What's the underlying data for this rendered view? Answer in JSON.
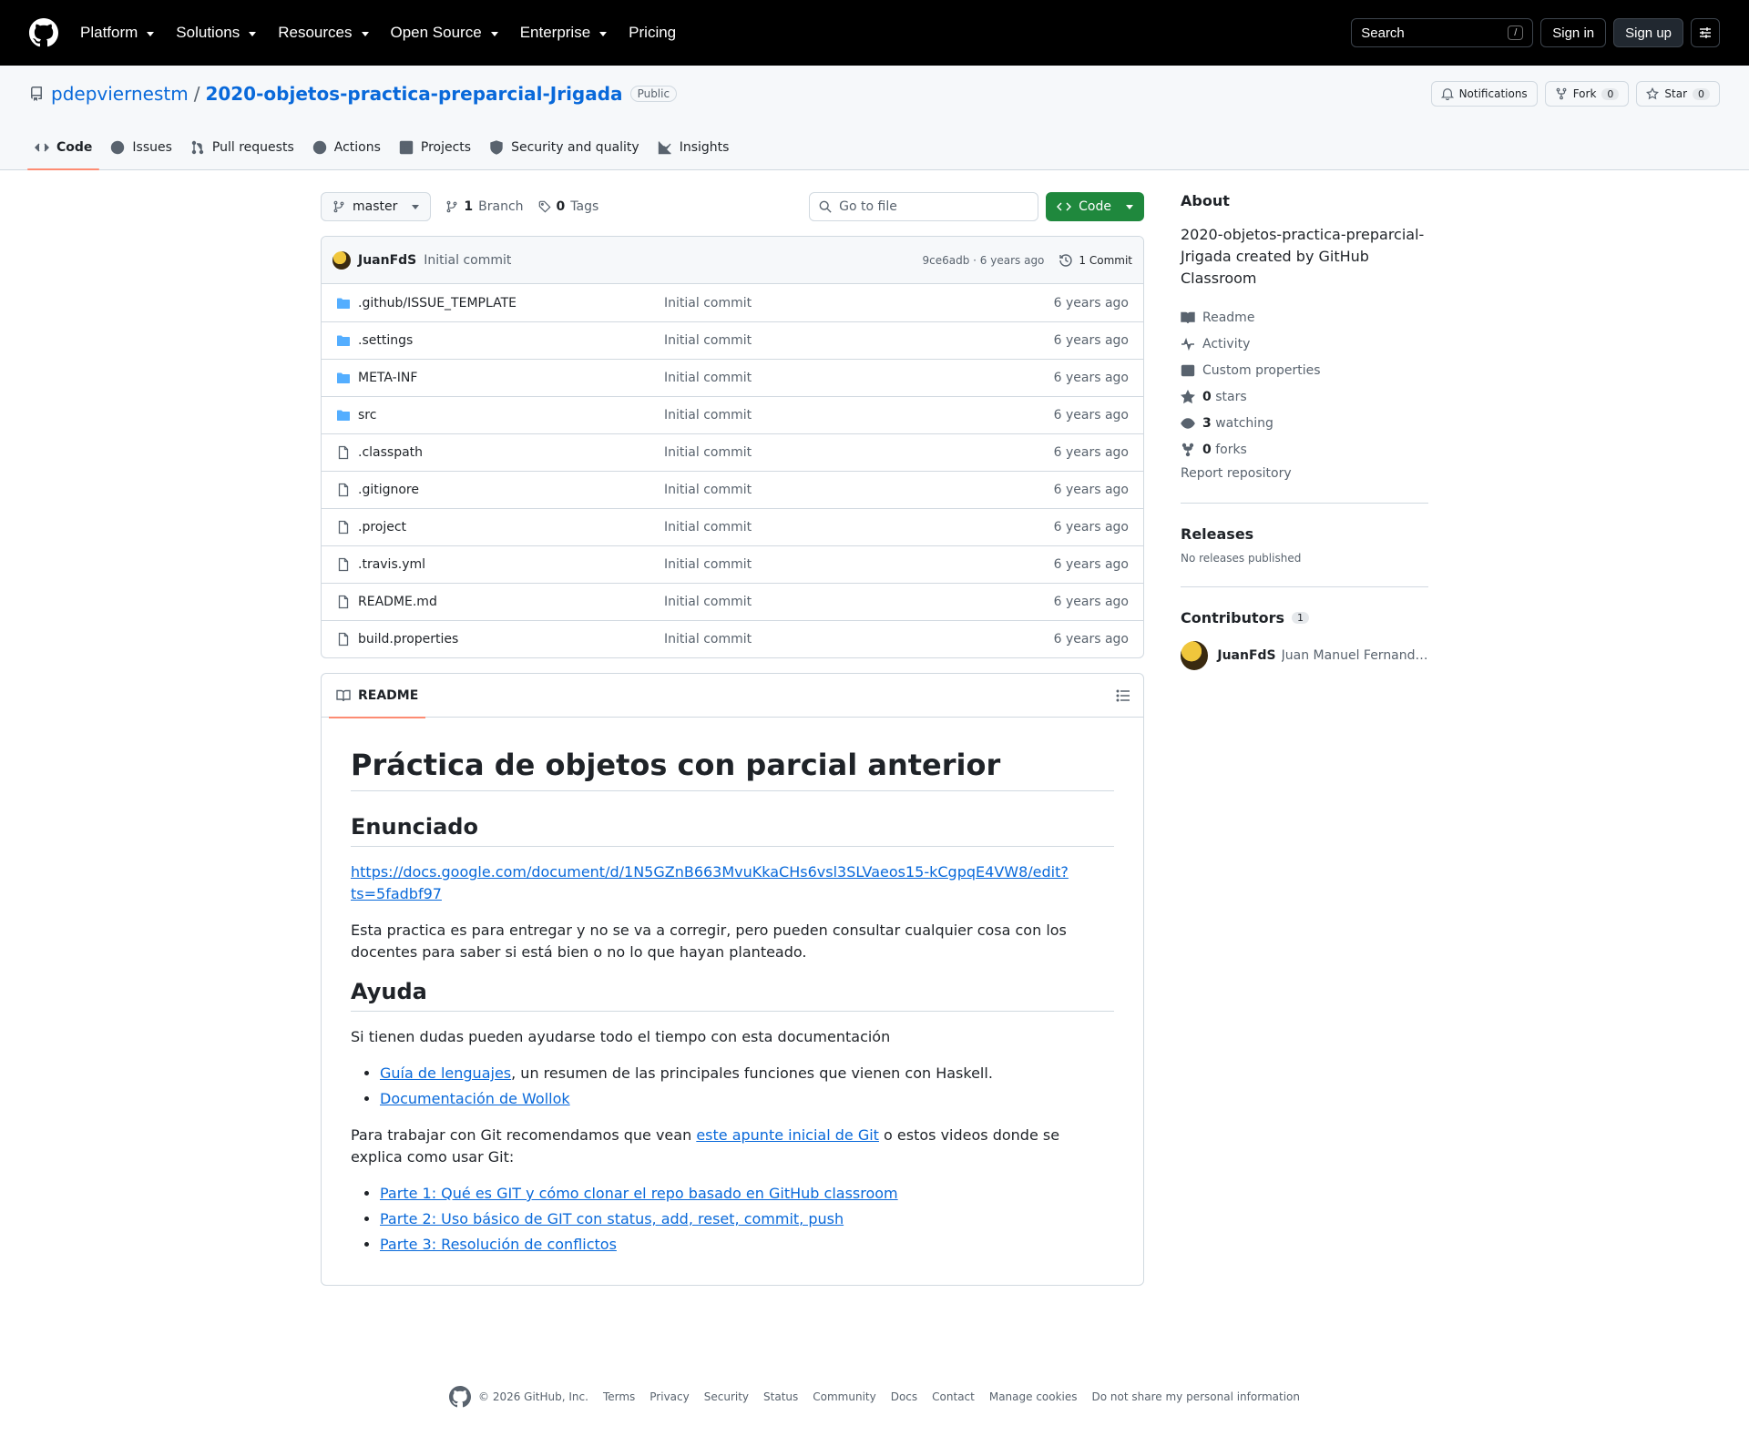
{
  "header": {
    "nav": [
      "Platform",
      "Solutions",
      "Resources",
      "Open Source",
      "Enterprise",
      "Pricing"
    ],
    "search_label": "Search",
    "search_kbd": "/",
    "signin": "Sign in",
    "signup": "Sign up"
  },
  "repo": {
    "owner": "pdepviernestm",
    "name": "2020-objetos-practica-preparcial-Jrigada",
    "visibility": "Public",
    "notifications": "Notifications",
    "fork_label": "Fork",
    "fork_count": "0",
    "star_label": "Star",
    "star_count": "0"
  },
  "tabs": [
    "Code",
    "Issues",
    "Pull requests",
    "Actions",
    "Projects",
    "Security and quality",
    "Insights"
  ],
  "filebar": {
    "branch": "master",
    "branch_count": "1",
    "branch_label": "Branch",
    "tag_count": "0",
    "tag_label": "Tags",
    "goto_placeholder": "Go to file",
    "code_button": "Code"
  },
  "latest_commit": {
    "author": "JuanFdS",
    "message": "Initial commit",
    "meta": "9ce6adb · 6 years ago",
    "count": "1 Commit"
  },
  "files": [
    {
      "name": ".github/ISSUE_TEMPLATE",
      "type": "dir",
      "commit": "Initial commit",
      "age": "6 years ago"
    },
    {
      "name": ".settings",
      "type": "dir",
      "commit": "Initial commit",
      "age": "6 years ago"
    },
    {
      "name": "META-INF",
      "type": "dir",
      "commit": "Initial commit",
      "age": "6 years ago"
    },
    {
      "name": "src",
      "type": "dir",
      "commit": "Initial commit",
      "age": "6 years ago"
    },
    {
      "name": ".classpath",
      "type": "file",
      "commit": "Initial commit",
      "age": "6 years ago"
    },
    {
      "name": ".gitignore",
      "type": "file",
      "commit": "Initial commit",
      "age": "6 years ago"
    },
    {
      "name": ".project",
      "type": "file",
      "commit": "Initial commit",
      "age": "6 years ago"
    },
    {
      "name": ".travis.yml",
      "type": "file",
      "commit": "Initial commit",
      "age": "6 years ago"
    },
    {
      "name": "README.md",
      "type": "file",
      "commit": "Initial commit",
      "age": "6 years ago"
    },
    {
      "name": "build.properties",
      "type": "file",
      "commit": "Initial commit",
      "age": "6 years ago"
    }
  ],
  "readme": {
    "tab": "README",
    "h1": "Práctica de objetos con parcial anterior",
    "h2_enunciado": "Enunciado",
    "doc_link": "https://docs.google.com/document/d/1N5GZnB663MvuKkaCHs6vsl3SLVaeos15-kCgpqE4VW8/edit?ts=5fadbf97",
    "p1": "Esta practica es para entregar y no se va a corregir, pero pueden consultar cualquier cosa con los docentes para saber si está bien o no lo que hayan planteado.",
    "h2_ayuda": "Ayuda",
    "p2": "Si tienen dudas pueden ayudarse todo el tiempo con esta documentación",
    "guia_link": "Guía de lenguajes",
    "guia_rest": ", un resumen de las principales funciones que vienen con Haskell.",
    "wollok_link": "Documentación de Wollok",
    "p3_a": "Para trabajar con Git recomendamos que vean ",
    "p3_link": "este apunte inicial de Git",
    "p3_b": " o estos videos donde se explica como usar Git:",
    "video1": "Parte 1: Qué es GIT y cómo clonar el repo basado en GitHub classroom",
    "video2": "Parte 2: Uso básico de GIT con status, add, reset, commit, push",
    "video3": "Parte 3: Resolución de conflictos"
  },
  "about": {
    "title": "About",
    "description": "2020-objetos-practica-preparcial-Jrigada created by GitHub Classroom",
    "readme": "Readme",
    "activity": "Activity",
    "custom": "Custom properties",
    "stars_n": "0",
    "stars": " stars",
    "watching_n": "3",
    "watching": " watching",
    "forks_n": "0",
    "forks": " forks",
    "report": "Report repository"
  },
  "releases": {
    "title": "Releases",
    "none": "No releases published"
  },
  "contributors": {
    "title": "Contributors",
    "count": "1",
    "login": "JuanFdS",
    "name": "Juan Manuel Fernandes dos Santos"
  },
  "footer": [
    "© 2026 GitHub, Inc.",
    "Terms",
    "Privacy",
    "Security",
    "Status",
    "Community",
    "Docs",
    "Contact",
    "Manage cookies",
    "Do not share my personal information"
  ]
}
